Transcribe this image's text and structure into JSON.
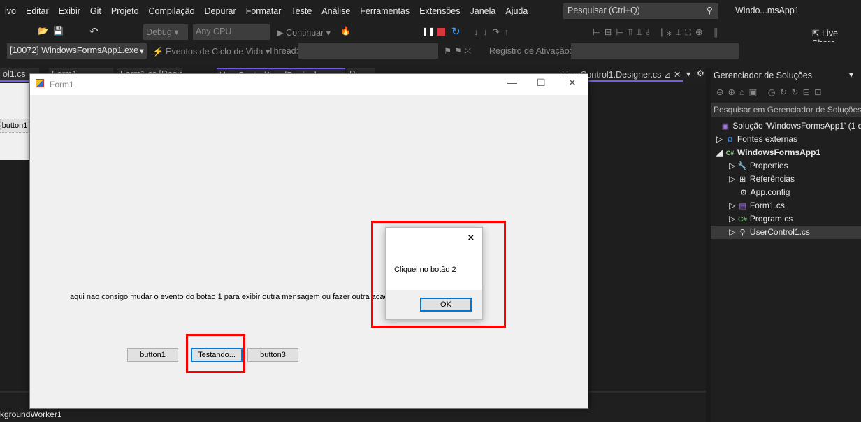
{
  "menu": [
    "ivo",
    "Editar",
    "Exibir",
    "Git",
    "Projeto",
    "Compilação",
    "Depurar",
    "Formatar",
    "Teste",
    "Análise",
    "Ferramentas",
    "Extensões",
    "Janela",
    "Ajuda"
  ],
  "search_placeholder": "Pesquisar (Ctrl+Q)",
  "window_title": "Windo...msApp1",
  "toolbar": {
    "config": "Debug",
    "platform": "Any CPU",
    "continue": "Continuar",
    "live_share": "Live Share"
  },
  "debug_bar": {
    "process": "[10072] WindowsFormsApp1.exe",
    "lifecycle": "Eventos de Ciclo de Vida",
    "thread": "Thread:",
    "activation": "Registro de Ativação:"
  },
  "tabs": [
    "ol1.cs",
    "Form1",
    "Form1.cs [Design]",
    "UserControl1.cs [Design]",
    "P",
    "UserControl1.Designer.cs"
  ],
  "designer": {
    "button1": "button1",
    "component": "kgroundWorker1"
  },
  "form": {
    "title": "Form1",
    "label": "aqui nao consigo mudar o evento do botao 1 para exibir outra mensagem ou fazer outra acao de                                    cionado ao formulario",
    "buttons": [
      "button1",
      "Testando...",
      "button3"
    ]
  },
  "dialog": {
    "message": "Cliquei no botão 2",
    "ok": "OK"
  },
  "solution_explorer": {
    "title": "Gerenciador de Soluções",
    "search": "Pesquisar em Gerenciador de Soluções",
    "items": [
      {
        "label": "Solução 'WindowsFormsApp1' (1 d",
        "icon": "solution-icon"
      },
      {
        "label": "Fontes externas",
        "icon": "external-sources-icon"
      },
      {
        "label": "WindowsFormsApp1",
        "icon": "csharp-project-icon"
      },
      {
        "label": "Properties",
        "icon": "wrench-icon"
      },
      {
        "label": "Referências",
        "icon": "references-icon"
      },
      {
        "label": "App.config",
        "icon": "config-icon"
      },
      {
        "label": "Form1.cs",
        "icon": "form-icon"
      },
      {
        "label": "Program.cs",
        "icon": "csharp-icon"
      },
      {
        "label": "UserControl1.cs",
        "icon": "usercontrol-icon"
      }
    ]
  },
  "colors": {
    "highlight": "#ff0000",
    "accent": "#0078d7",
    "tab_active": "#7160e8"
  }
}
